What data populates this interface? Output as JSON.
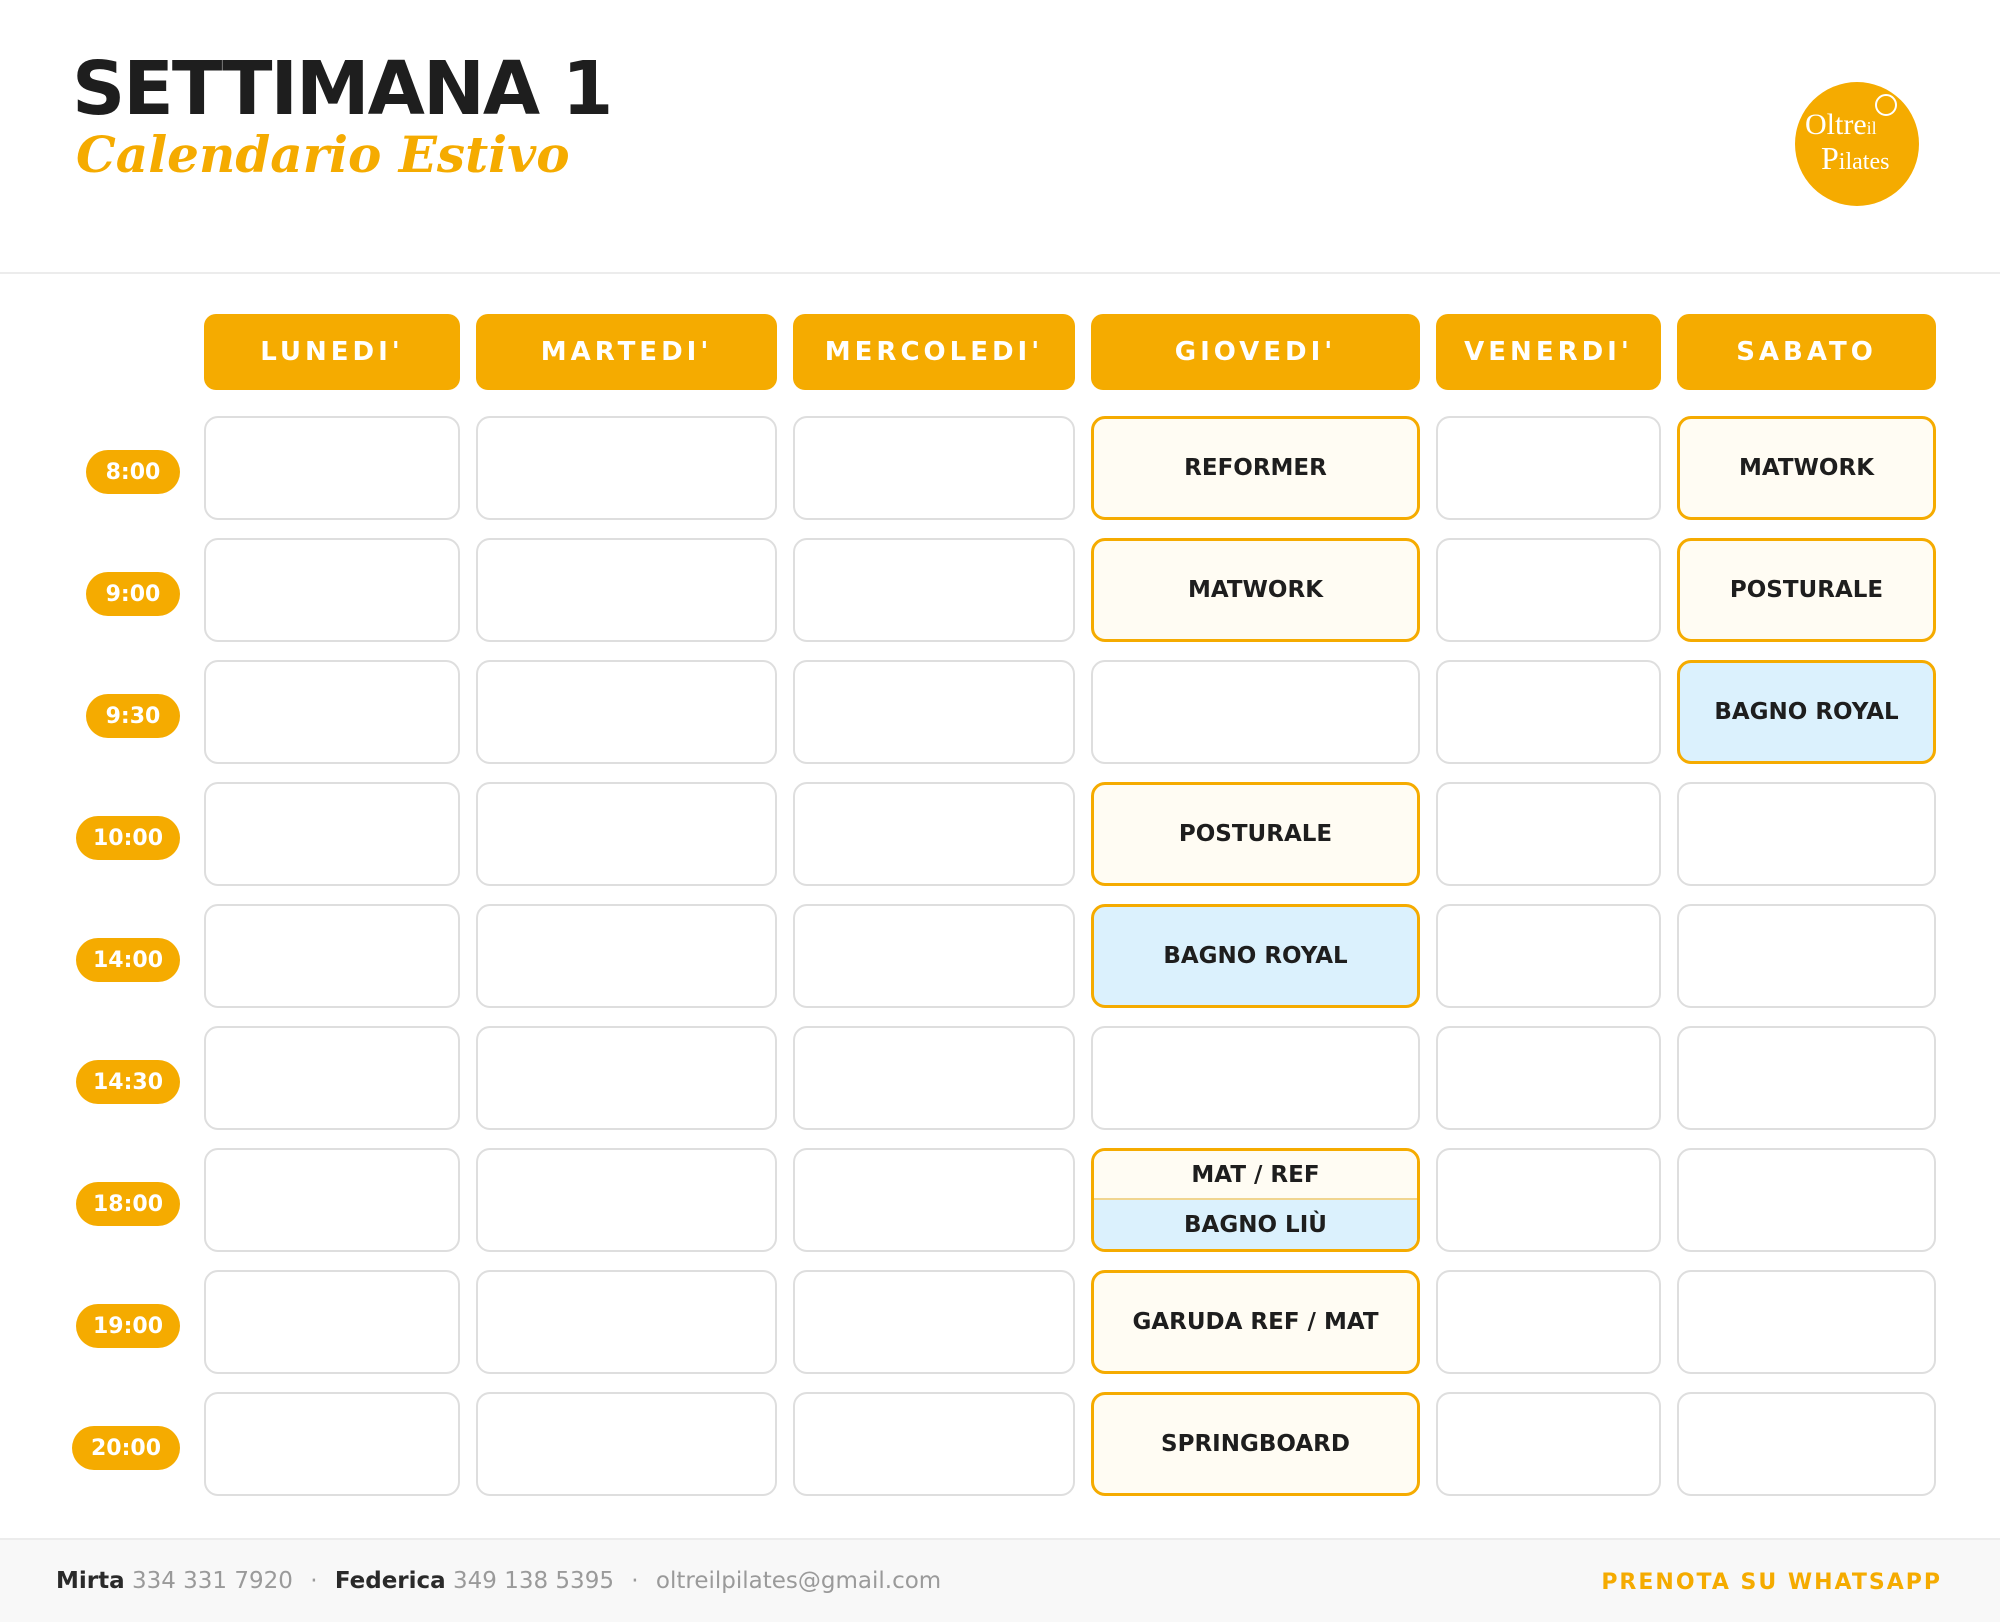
{
  "header": {
    "title": "SETTIMANA 1",
    "subtitle": "Calendario Estivo",
    "logo": {
      "line1": "Oltre",
      "line1_small": "il",
      "line2": "P",
      "line2_small": "ilates"
    }
  },
  "days": [
    "LUNEDI'",
    "MARTEDI'",
    "MERCOLEDI'",
    "GIOVEDI'",
    "VENERDI'",
    "SABATO"
  ],
  "times": [
    "8:00",
    "9:00",
    "9:30",
    "10:00",
    "14:00",
    "14:30",
    "18:00",
    "19:00",
    "20:00"
  ],
  "classes": {
    "thu": {
      "t0800": "REFORMER",
      "t0900": "MATWORK",
      "t1000": "POSTURALE",
      "t1400": "BAGNO ROYAL",
      "t1800_top": "MAT / REF",
      "t1800_bottom": "BAGNO LIÙ",
      "t1900": "GARUDA REF / MAT",
      "t2000": "SPRINGBOARD"
    },
    "sat": {
      "t0800": "MATWORK",
      "t0900": "POSTURALE",
      "t0930": "BAGNO ROYAL"
    }
  },
  "colors": {
    "accent": "#f5ab00",
    "class_bg": "#fffcf3",
    "beach_bg": "#dbf1fd",
    "empty_border": "#dedede"
  },
  "footer": {
    "contact1_name": "Mirta",
    "contact1_phone": "334 331 7920",
    "contact2_name": "Federica",
    "contact2_phone": "349 138 5395",
    "email": "oltreilpilates@gmail.com",
    "separator": "·",
    "cta": "PRENOTA SU WHATSAPP"
  }
}
